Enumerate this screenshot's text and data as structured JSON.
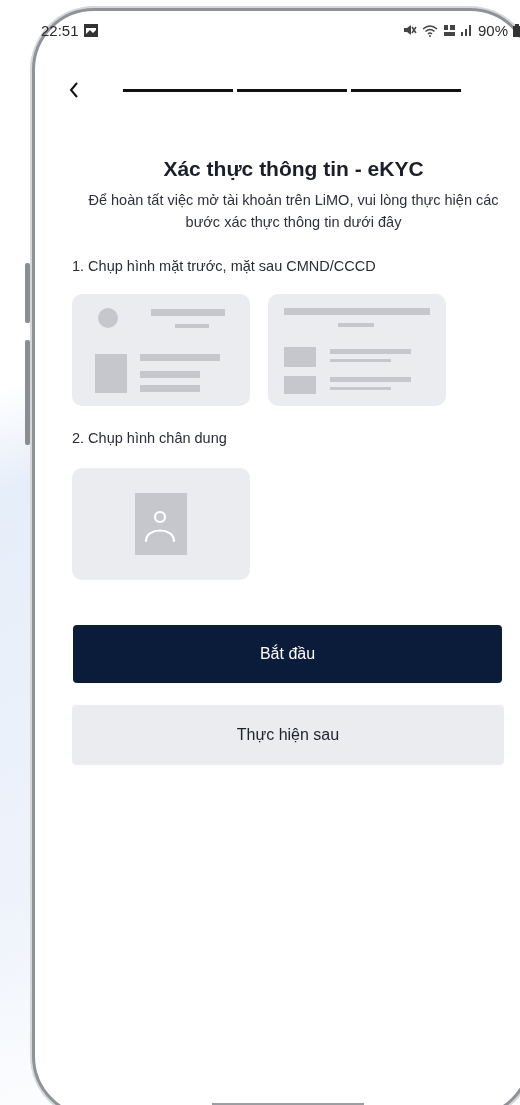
{
  "status_bar": {
    "time": "22:51",
    "battery": "90%"
  },
  "progress": {
    "steps": [
      {
        "done": true
      },
      {
        "done": true
      },
      {
        "done": true
      }
    ]
  },
  "title": "Xác thực thông tin - eKYC",
  "subtitle": "Để hoàn tất việc mở tài khoản trên LiMO, vui lòng thực hiện các bước xác thực thông tin dưới đây",
  "sections": [
    {
      "label": "1. Chụp hình mặt trước, mặt sau CMND/CCCD",
      "cards": [
        {
          "kind": "id_front"
        },
        {
          "kind": "id_back"
        }
      ]
    },
    {
      "label": "2. Chụp hình chân dung",
      "cards": [
        {
          "kind": "portrait"
        }
      ]
    }
  ],
  "buttons": [
    {
      "label": "Bắt đầu",
      "kind": "primary"
    },
    {
      "label": "Thực hiện sau",
      "kind": "secondary"
    }
  ]
}
